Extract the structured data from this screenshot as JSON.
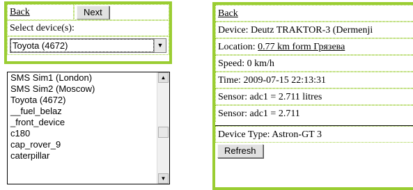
{
  "left_panel": {
    "back_label": "Back",
    "next_label": "Next",
    "select_label": "Select device(s):",
    "selected_value": "Toyota (4672)"
  },
  "dropdown": {
    "options": [
      "SMS Sim1 (London)",
      "SMS Sim2 (Moscow)",
      "Toyota (4672)",
      "__fuel_belaz",
      "_front_device",
      "c180",
      "cap_rover_9",
      "caterpillar"
    ],
    "scroll_position": 0.55,
    "scroll_visible_fraction": 0.12
  },
  "right_panel": {
    "back_label": "Back",
    "device_text": "Device: Deutz TRAKTOR-3 (Dermenji",
    "location_prefix": "Location: ",
    "location_link": "0.77 km form Грязева",
    "speed_text": "Speed: 0 km/h",
    "time_text": "Time: 2009-07-15 22:13:31",
    "sensor1_text": "Sensor: adc1 = 2.711 litres",
    "sensor2_text": "Sensor: adc1 = 2.711",
    "device_type_text": "Device Type: Astron-GT 3",
    "refresh_label": "Refresh"
  },
  "colors": {
    "border_accent": "#9acd32"
  }
}
